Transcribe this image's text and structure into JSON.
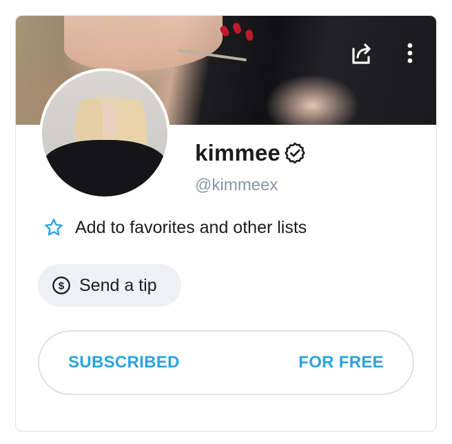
{
  "profile": {
    "name": "kimmee",
    "handle": "@kimmeex",
    "verified": true
  },
  "actions": {
    "favorites_label": "Add to favorites and other lists",
    "tip_label": "Send a tip",
    "subscribe_status": "SUBSCRIBED",
    "subscribe_price": "FOR FREE"
  },
  "icons": {
    "share": "share-icon",
    "more": "more-vertical-icon",
    "verified": "verified-badge-icon",
    "star": "star-outline-icon",
    "dollar": "dollar-circle-icon"
  },
  "colors": {
    "accent": "#2aa3dd",
    "muted_text": "#8a96a3",
    "tip_background": "#eef0f3",
    "border": "#dcdfe3"
  }
}
